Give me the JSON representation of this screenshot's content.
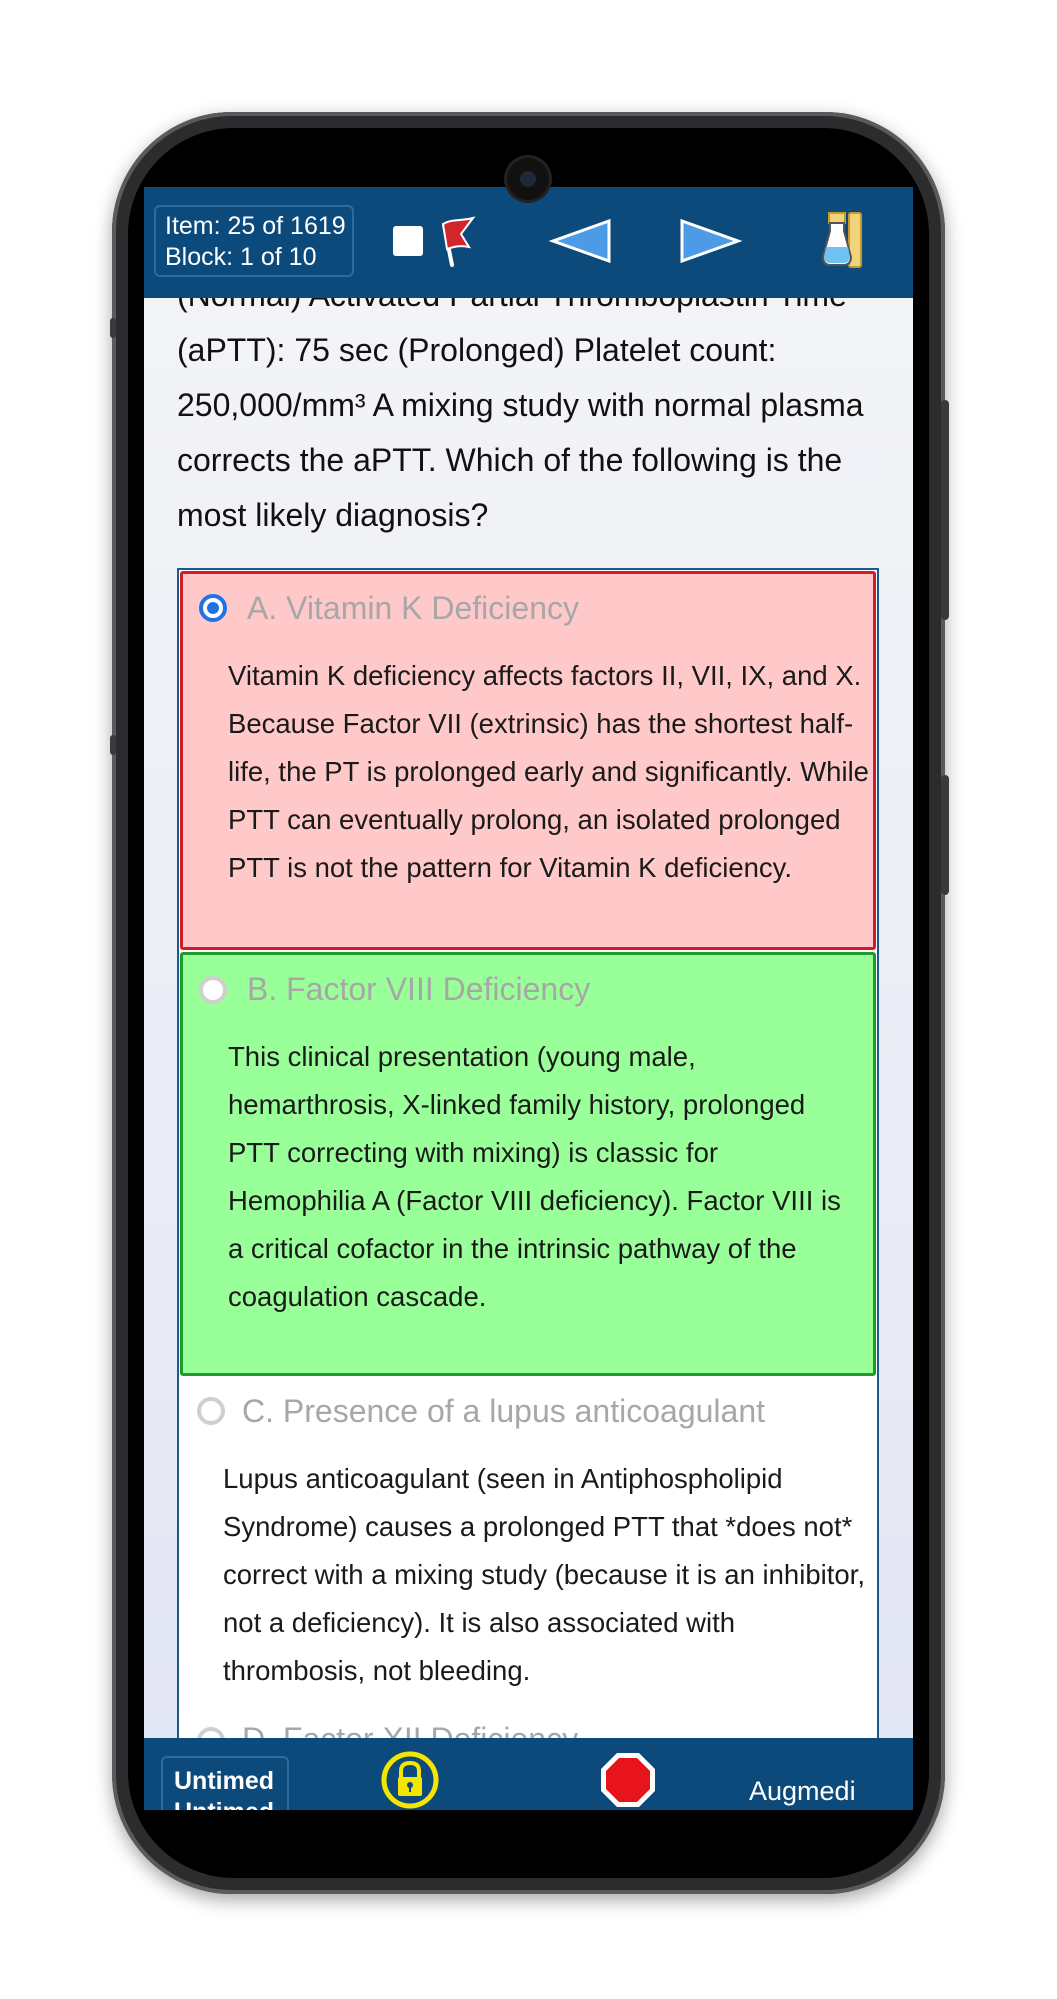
{
  "header": {
    "item_label": "Item: 25 of 1619",
    "block_label": "Block: 1 of 10"
  },
  "question": {
    "text": "(Normal) Activated Partial Thromboplastin Time (aPTT): 75 sec (Prolonged) Platelet count: 250,000/mm³ A mixing study with normal plasma corrects the aPTT. Which of the following is the most likely diagnosis?"
  },
  "options": [
    {
      "label": "A. Vitamin K Deficiency",
      "explanation": "Vitamin K deficiency affects factors II, VII, IX, and X. Because Factor VII (extrinsic) has the shortest half-life, the PT is prolonged early and significantly. While PTT can eventually prolong, an isolated prolonged PTT is not the pattern for Vitamin K deficiency.",
      "selected": true,
      "status": "incorrect"
    },
    {
      "label": "B. Factor VIII Deficiency",
      "explanation": "This clinical presentation (young male, hemarthrosis, X-linked family history, prolonged PTT correcting with mixing) is classic for Hemophilia A (Factor VIII deficiency). Factor VIII is a critical cofactor in the intrinsic pathway of the coagulation cascade.",
      "selected": false,
      "status": "correct"
    },
    {
      "label": "C. Presence of a lupus anticoagulant",
      "explanation": "Lupus anticoagulant (seen in Antiphospholipid Syndrome) causes a prolonged PTT that *does not* correct with a mixing study (because it is an inhibitor, not a deficiency). It is also associated with thrombosis, not bleeding.",
      "selected": false,
      "status": "neutral"
    },
    {
      "label": "D. Factor XII Deficiency",
      "explanation": "",
      "selected": false,
      "status": "neutral"
    }
  ],
  "footer": {
    "timer_line1": "Untimed",
    "timer_line2": "Untimed",
    "brand": "Augmedi"
  },
  "colors": {
    "bar_blue": "#0d4a7c",
    "incorrect_bg": "#ffc9c9",
    "incorrect_border": "#d11a2a",
    "correct_bg": "#99ff99",
    "correct_border": "#1d9a28",
    "radio_blue": "#1e74e6"
  },
  "icons": [
    "flag-icon",
    "previous-arrow-icon",
    "next-arrow-icon",
    "lab-values-icon",
    "lock-icon",
    "stop-icon",
    "camera-icon"
  ]
}
